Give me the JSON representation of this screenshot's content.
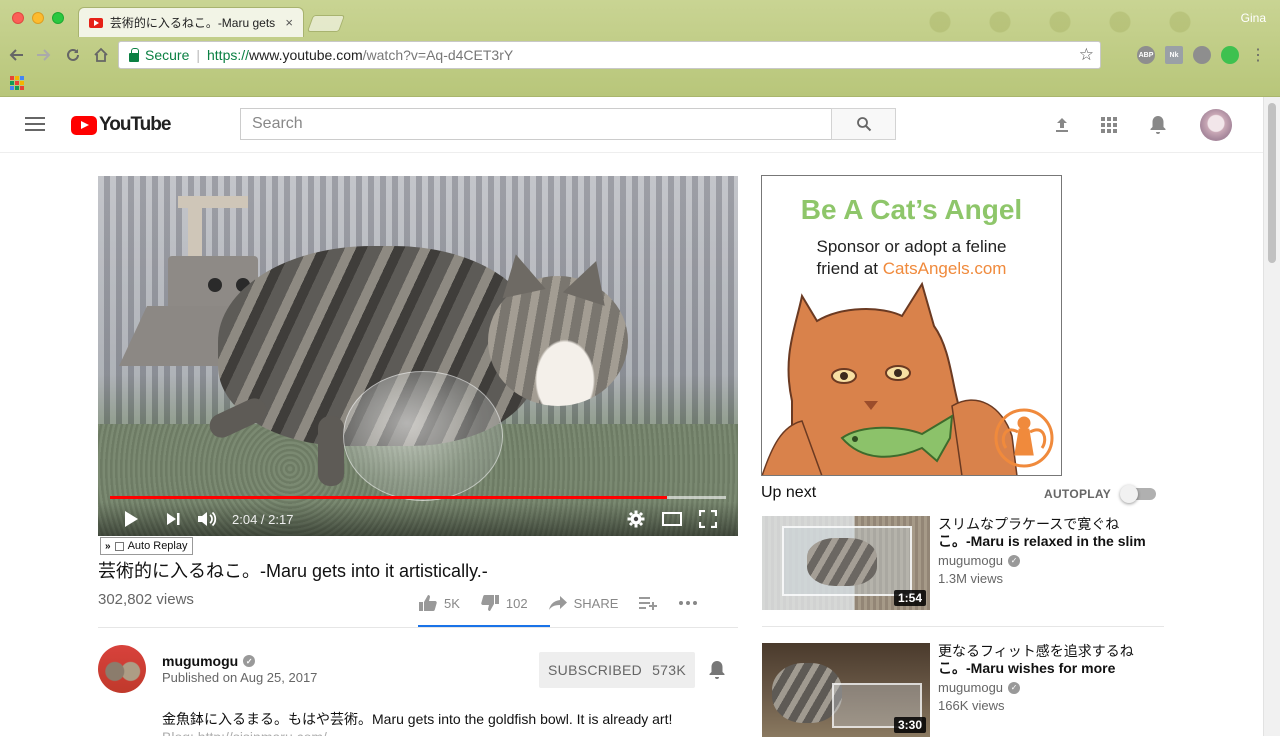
{
  "browser": {
    "tab_title": "芸術的に入るねこ。-Maru gets",
    "tab_close": "×",
    "profile_name": "Gina",
    "secure_label": "Secure",
    "url_scheme": "https://",
    "url_host": "www.youtube.com",
    "url_path": "/watch?v=Aq-d4CET3rY",
    "extensions": [
      "ABP",
      "Nk",
      "sync",
      "power"
    ]
  },
  "masthead": {
    "logo_text": "YouTube",
    "search_placeholder": "Search"
  },
  "player": {
    "current_time": "2:04",
    "duration": "2:17",
    "time_display": "2:04 / 2:17",
    "progress_fraction": 0.904,
    "buffered_fraction": 1.0,
    "auto_replay_label": "Auto Replay"
  },
  "video": {
    "title": "芸術的に入るねこ。-Maru gets into it artistically.-",
    "views": "302,802 views",
    "likes": "5K",
    "dislikes": "102",
    "share_label": "SHARE"
  },
  "channel": {
    "name": "mugumogu",
    "published": "Published on Aug 25, 2017",
    "subscribed_label": "SUBSCRIBED",
    "subscriber_count": "573K",
    "description": "金魚鉢に入るまる。もはや芸術。Maru gets into the goldfish bowl. It is already art!",
    "description_more": "Blog: http://sisinmaru.com/"
  },
  "ad": {
    "headline": "Be A Cat’s Angel",
    "line1": "Sponsor or adopt a feline",
    "line2_prefix": "friend at ",
    "link": "CatsAngels.com"
  },
  "sidebar": {
    "up_next_label": "Up next",
    "autoplay_label": "AUTOPLAY",
    "autoplay_on": false,
    "recommendations": [
      {
        "title_jp": "スリムなプラケースで寛ぐね",
        "title_rest": "こ。-Maru is relaxed in the slim",
        "channel": "mugumogu",
        "views": "1.3M views",
        "duration": "1:54"
      },
      {
        "title_jp": "更なるフィット感を追求するね",
        "title_rest": "こ。-Maru wishes for more",
        "channel": "mugumogu",
        "views": "166K views",
        "duration": "3:30"
      }
    ]
  },
  "colors": {
    "brand_red": "#ff0000",
    "progress_red": "#ff0000",
    "secure_green": "#0b8043",
    "ad_green": "#8ec66a",
    "ad_orange": "#f08a3c"
  }
}
